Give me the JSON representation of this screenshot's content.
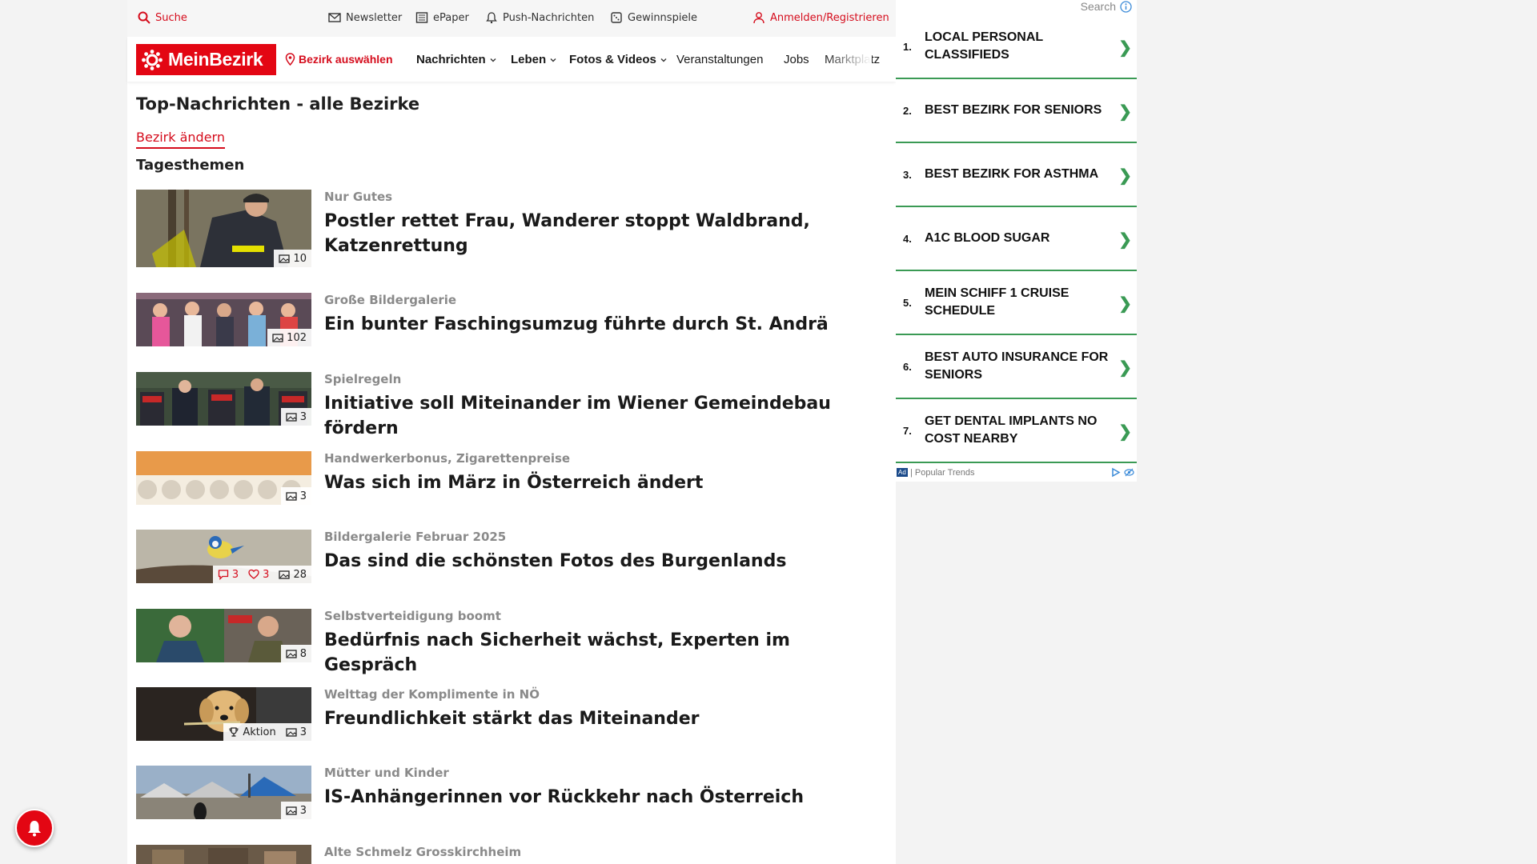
{
  "topbar": {
    "search": "Suche",
    "newsletter": "Newsletter",
    "epaper": "ePaper",
    "push": "Push-Nachrichten",
    "games": "Gewinnspiele",
    "login": "Anmelden/Registrieren"
  },
  "nav": {
    "logo": "MeinBezirk",
    "select_district": "Bezirk auswählen",
    "news": "Nachrichten",
    "life": "Leben",
    "photos": "Fotos & Videos",
    "events": "Veranstaltungen",
    "jobs": "Jobs",
    "market": "Marktplatz"
  },
  "main": {
    "title": "Top-Nachrichten - alle Bezirke",
    "change_district": "Bezirk ändern",
    "section": "Tagesthemen",
    "articles": [
      {
        "kicker": "Nur Gutes",
        "headline": "Postler rettet Frau, Wanderer stoppt Waldbrand, Katzenrettung",
        "images": "10"
      },
      {
        "kicker": "Große Bildergalerie",
        "headline": "Ein bunter Faschingsumzug führte durch St. Andrä",
        "images": "102"
      },
      {
        "kicker": "Spielregeln",
        "headline": "Initiative soll Miteinander im Wiener Gemeindebau fördern",
        "images": "3"
      },
      {
        "kicker": "Handwerkerbonus, Zigarettenpreise",
        "headline": "Was sich im März in Österreich ändert",
        "images": "3"
      },
      {
        "kicker": "Bildergalerie Februar 2025",
        "headline": "Das sind die schönsten Fotos des Burgenlands",
        "comments": "3",
        "likes": "3",
        "images": "28"
      },
      {
        "kicker": "Selbstverteidigung boomt",
        "headline": "Bedürfnis nach Sicherheit wächst, Experten im Gespräch",
        "images": "8"
      },
      {
        "kicker": "Welttag der Komplimente in NÖ",
        "headline": "Freundlichkeit stärkt das Miteinander",
        "action": "Aktion",
        "images": "3"
      },
      {
        "kicker": "Mütter und Kinder",
        "headline": "IS-Anhängerinnen vor Rückkehr nach Österreich",
        "images": "3"
      },
      {
        "kicker": "Alte Schmelz Grosskirchheim",
        "headline": ""
      }
    ]
  },
  "ad": {
    "search": "Search",
    "items": [
      {
        "num": "1.",
        "text": "LOCAL PERSONAL CLASSIFIEDS"
      },
      {
        "num": "2.",
        "text": "BEST BEZIRK FOR SENIORS"
      },
      {
        "num": "3.",
        "text": "BEST BEZIRK FOR ASTHMA"
      },
      {
        "num": "4.",
        "text": "A1C BLOOD SUGAR"
      },
      {
        "num": "5.",
        "text": "MEIN SCHIFF 1 CRUISE SCHEDULE"
      },
      {
        "num": "6.",
        "text": "BEST AUTO INSURANCE FOR SENIORS"
      },
      {
        "num": "7.",
        "text": "GET DENTAL IMPLANTS NO COST NEARBY"
      }
    ],
    "mark": "Ad",
    "footer": "| Popular Trends"
  },
  "colors": {
    "brand": "#e30613",
    "accent_red": "#d50c1c",
    "ad_green": "#3a9a54"
  }
}
